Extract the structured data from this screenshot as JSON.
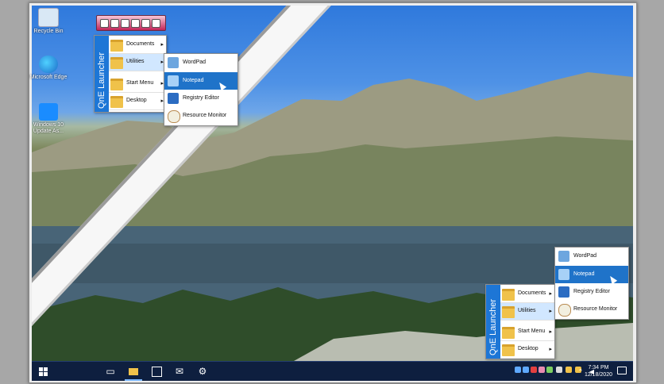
{
  "desktop_icons": [
    {
      "label": "Recycle Bin",
      "icon": "recycle-bin-icon"
    },
    {
      "label": "Microsoft Edge",
      "icon": "edge-icon"
    },
    {
      "label": "Windows 10 Update As...",
      "icon": "windows-update-icon"
    }
  ],
  "launcher": {
    "title": "QnE Launcher",
    "items": [
      "Documents",
      "Utilities",
      "Start Menu",
      "Desktop"
    ]
  },
  "utilities_submenu": [
    "WordPad",
    "Notepad",
    "Registry Editor",
    "Resource Monitor"
  ],
  "taskbar": {
    "time": "7:34 PM",
    "date": "12/18/2020",
    "apps": [
      "task-view-icon",
      "file-explorer-icon",
      "store-icon",
      "mail-icon",
      "settings-icon"
    ]
  },
  "colors": {
    "accent": "#1f73c9",
    "taskbar": "#0e1f3f",
    "launcher_side": "#1d76d6",
    "folder": "#f0c24a"
  }
}
